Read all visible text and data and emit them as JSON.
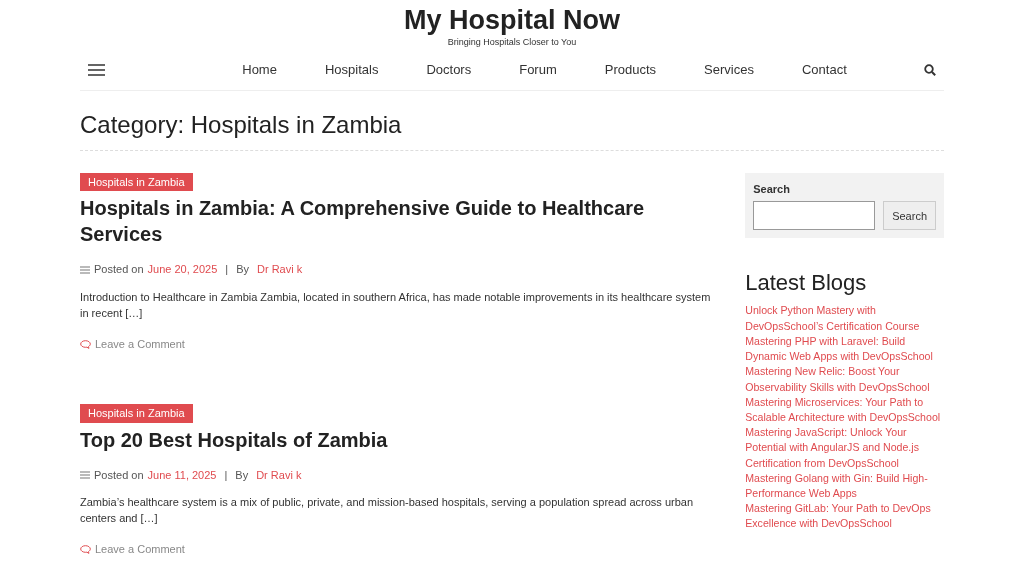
{
  "site": {
    "title": "My Hospital Now",
    "tagline": "Bringing Hospitals Closer to You"
  },
  "nav": [
    "Home",
    "Hospitals",
    "Doctors",
    "Forum",
    "Products",
    "Services",
    "Contact"
  ],
  "page_title": "Category: Hospitals in Zambia",
  "posts": [
    {
      "category": "Hospitals in Zambia",
      "title": "Hospitals in Zambia: A Comprehensive Guide to Healthcare Services",
      "posted_label": "Posted on",
      "date": "June 20, 2025",
      "separator": "|",
      "by_label": "By",
      "author": "Dr Ravi k",
      "excerpt": "Introduction to Healthcare in Zambia Zambia, located in southern Africa, has made notable improvements in its healthcare system in recent […]",
      "comment_link": "Leave a Comment"
    },
    {
      "category": "Hospitals in Zambia",
      "title": "Top 20 Best Hospitals of Zambia",
      "posted_label": "Posted on",
      "date": "June 11, 2025",
      "separator": "|",
      "by_label": "By",
      "author": "Dr Ravi k",
      "excerpt": "Zambia’s healthcare system is a mix of public, private, and mission-based hospitals, serving a population spread across urban centers and […]",
      "comment_link": "Leave a Comment"
    }
  ],
  "sidebar": {
    "search": {
      "label": "Search",
      "button": "Search"
    },
    "latest_blogs": {
      "heading": "Latest Blogs",
      "items": [
        "Unlock Python Mastery with DevOpsSchool’s Certification Course",
        "Mastering PHP with Laravel: Build Dynamic Web Apps with DevOpsSchool",
        "Mastering New Relic: Boost Your Observability Skills with DevOpsSchool",
        "Mastering Microservices: Your Path to Scalable Architecture with DevOpsSchool",
        "Mastering JavaScript: Unlock Your Potential with AngularJS and Node.js Certification from DevOpsSchool",
        "Mastering Golang with Gin: Build High-Performance Web Apps",
        "Mastering GitLab: Your Path to DevOps Excellence with DevOpsSchool"
      ]
    }
  }
}
